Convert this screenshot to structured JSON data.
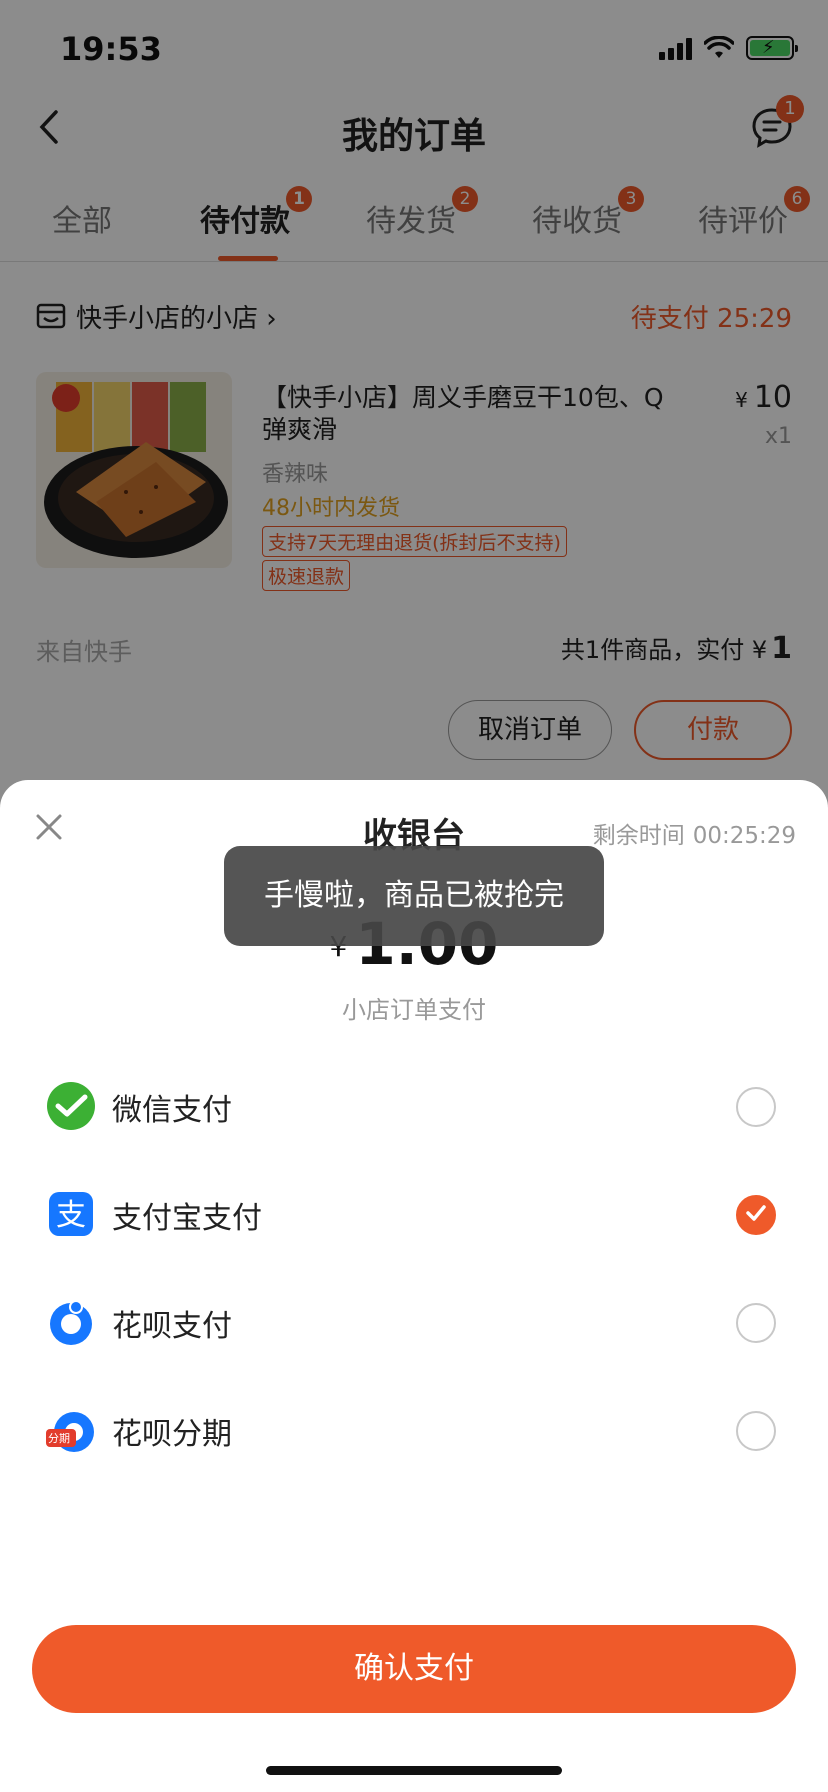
{
  "status_bar": {
    "time": "19:53"
  },
  "nav": {
    "title": "我的订单",
    "message_badge": "1"
  },
  "tabs": [
    {
      "label": "全部",
      "badge": ""
    },
    {
      "label": "待付款",
      "badge": "1"
    },
    {
      "label": "待发货",
      "badge": "2"
    },
    {
      "label": "待收货",
      "badge": "3"
    },
    {
      "label": "待评价",
      "badge": "6"
    }
  ],
  "order": {
    "shop_name": "快手小店的小店",
    "shop_chevron": "›",
    "status": "待支付 25:29",
    "product_title": "【快手小店】周义手磨豆干10包、Q弹爽滑",
    "currency": "¥",
    "price": "10",
    "qty": "x1",
    "variant": "香辣味",
    "shipping": "48小时内发货",
    "tags": [
      "支持7天无理由退货(拆封后不支持)",
      "极速退款"
    ],
    "source": "来自快手",
    "total_label": "共1件商品，实付",
    "total_currency": "¥",
    "total_value": "1",
    "cancel_label": "取消订单",
    "pay_label": "付款"
  },
  "sheet": {
    "title": "收银台",
    "remain_label": "剩余时间",
    "remain_time": "00:25:29",
    "currency": "¥",
    "amount": "1.00",
    "subtitle": "小店订单支付",
    "options": [
      {
        "label": "微信支付",
        "icon": "wechat-pay-icon",
        "checked": false
      },
      {
        "label": "支付宝支付",
        "icon": "alipay-icon",
        "checked": true
      },
      {
        "label": "花呗支付",
        "icon": "huabei-icon",
        "checked": false
      },
      {
        "label": "花呗分期",
        "icon": "huabei-installment-icon",
        "checked": false
      }
    ],
    "installment_badge": "分期",
    "confirm_label": "确认支付"
  },
  "toast": {
    "text": "手慢啦，商品已被抢完"
  },
  "colors": {
    "accent": "#ef5a2a",
    "wechat": "#3cb034",
    "alipay": "#1677ff"
  }
}
